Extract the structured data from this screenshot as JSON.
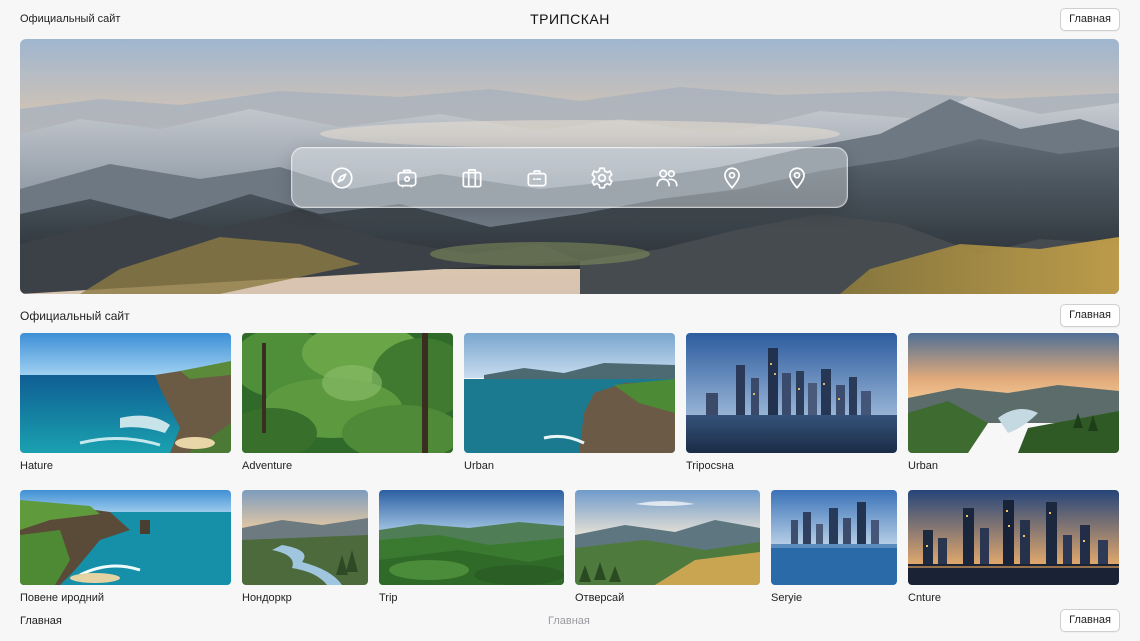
{
  "header": {
    "site_link": "Официальный сайт",
    "brand": "ТРИПСКАН",
    "button": "Главная"
  },
  "hero": {
    "icons": [
      "compass-icon",
      "luggage-icon",
      "suitcase-icon",
      "briefcase-icon",
      "gear-icon",
      "users-icon",
      "map-pin-icon",
      "map-pin-icon"
    ]
  },
  "section": {
    "title": "Официальный сайт",
    "button": "Главная"
  },
  "row1": [
    {
      "label": "Hature",
      "scene": "coast"
    },
    {
      "label": "Adventure",
      "scene": "forest"
    },
    {
      "label": "Urban",
      "scene": "cliff"
    },
    {
      "label": "Tripocsна",
      "scene": "city"
    },
    {
      "label": "Urban",
      "scene": "valley"
    }
  ],
  "row2": [
    {
      "label": "Повене иродний",
      "scene": "coast"
    },
    {
      "label": "Нондоркр",
      "scene": "river"
    },
    {
      "label": "Trip",
      "scene": "forest"
    },
    {
      "label": "Отверсай",
      "scene": "valley"
    },
    {
      "label": "Seryie",
      "scene": "city"
    },
    {
      "label": "Cnture",
      "scene": "citynight"
    }
  ],
  "footer": {
    "left": "Главная",
    "center": "Главная",
    "button": "Главная"
  }
}
